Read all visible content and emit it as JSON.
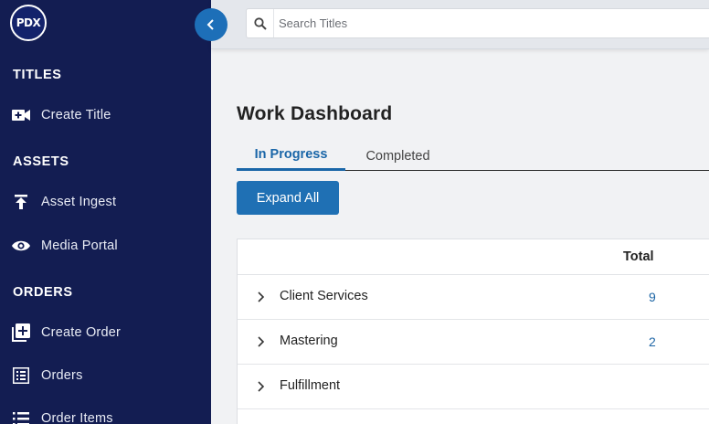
{
  "sidebar": {
    "logo_text": "PDX",
    "sections": [
      {
        "title": "TITLES"
      },
      {
        "title": "ASSETS"
      },
      {
        "title": "ORDERS"
      }
    ],
    "items": [
      {
        "label": "Create Title",
        "icon": "video-plus-icon"
      },
      {
        "label": "Asset Ingest",
        "icon": "upload-icon"
      },
      {
        "label": "Media Portal",
        "icon": "eye-icon"
      },
      {
        "label": "Create Order",
        "icon": "add-box-icon"
      },
      {
        "label": "Orders",
        "icon": "list-box-icon"
      },
      {
        "label": "Order Items",
        "icon": "list-icon"
      }
    ]
  },
  "search": {
    "placeholder": "Search Titles",
    "value": ""
  },
  "main": {
    "title": "Work Dashboard",
    "tabs": [
      {
        "label": "In Progress",
        "active": true
      },
      {
        "label": "Completed",
        "active": false
      }
    ],
    "expand_label": "Expand All",
    "table": {
      "columns": [
        "",
        "Total"
      ],
      "rows": [
        {
          "name": "Client Services",
          "total": "9"
        },
        {
          "name": "Mastering",
          "total": "2"
        },
        {
          "name": "Fulfillment",
          "total": ""
        }
      ]
    }
  },
  "colors": {
    "sidebar": "#131d52",
    "accent": "#1f70b4",
    "link": "#1e66a6"
  }
}
